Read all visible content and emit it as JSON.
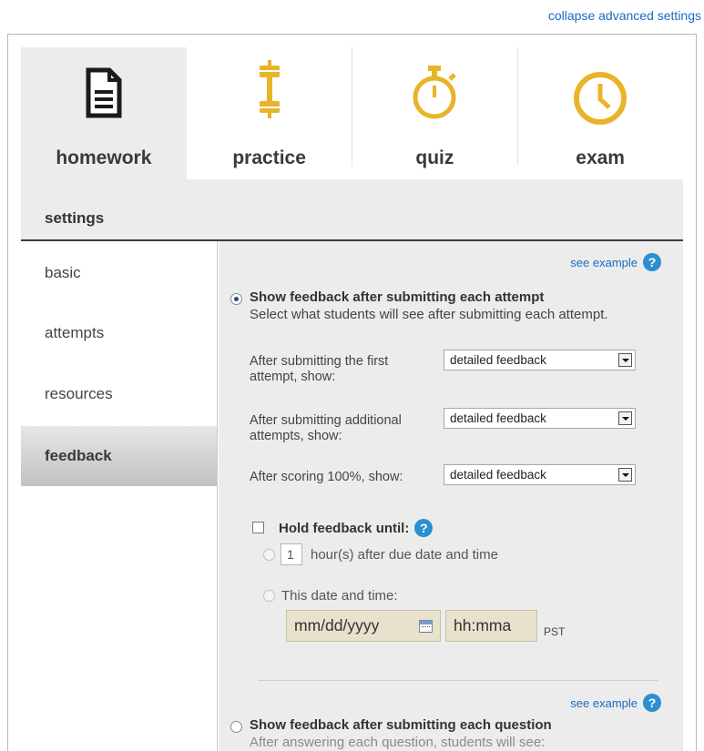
{
  "header": {
    "collapse_link": "collapse advanced settings"
  },
  "tabs": [
    {
      "label": "homework",
      "icon": "document-icon",
      "active": true
    },
    {
      "label": "practice",
      "icon": "dumbbell-icon",
      "active": false
    },
    {
      "label": "quiz",
      "icon": "stopwatch-icon",
      "active": false
    },
    {
      "label": "exam",
      "icon": "clock-icon",
      "active": false
    }
  ],
  "colors": {
    "icon_yellow": "#e9b428",
    "link_blue": "#1a6bc6",
    "help_blue": "#2b8fd0"
  },
  "settings": {
    "title": "settings"
  },
  "sidenav": {
    "items": [
      {
        "label": "basic",
        "active": false
      },
      {
        "label": "attempts",
        "active": false
      },
      {
        "label": "resources",
        "active": false
      },
      {
        "label": "feedback",
        "active": true
      }
    ]
  },
  "feedback": {
    "see_example": "see example",
    "option1": {
      "heading": "Show feedback after submitting each attempt",
      "selected": true,
      "description": "Select what students will see after submitting each attempt.",
      "rows": [
        {
          "label": "After submitting the first attempt, show:",
          "value": "detailed feedback"
        },
        {
          "label": "After submitting additional attempts, show:",
          "value": "detailed feedback"
        },
        {
          "label": "After scoring 100%, show:",
          "value": "detailed feedback"
        }
      ],
      "hold": {
        "label": "Hold feedback until:",
        "checked": false,
        "hours_value": "1",
        "hours_label": "hour(s) after due date and time",
        "date_label": "This date and time:",
        "date_placeholder": "mm/dd/yyyy",
        "time_placeholder": "hh:mma",
        "timezone": "PST"
      }
    },
    "option2": {
      "see_example": "see example",
      "heading": "Show feedback after submitting each question",
      "selected": false,
      "description": "After answering each question, students will see:"
    }
  }
}
